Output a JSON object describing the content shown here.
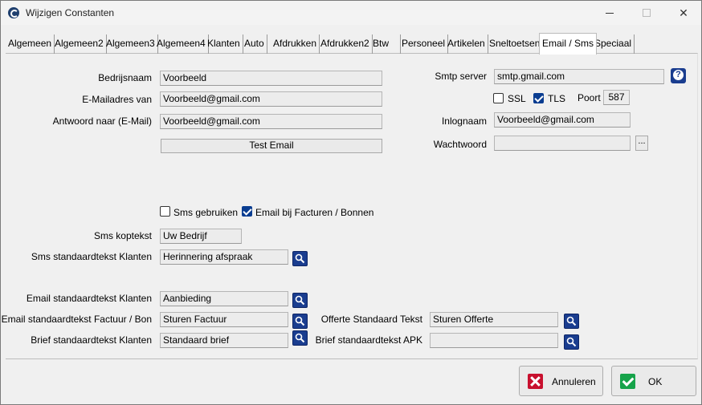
{
  "window": {
    "title": "Wijzigen Constanten"
  },
  "tabs": [
    "Algemeen",
    "Algemeen2",
    "Algemeen3",
    "Algemeen4",
    "Klanten",
    "Auto",
    "Afdrukken",
    "Afdrukken2",
    "Btw",
    "Personeel",
    "Artikelen",
    "Sneltoetsen",
    "Email / Sms",
    "Speciaal"
  ],
  "active_tab": "Email / Sms",
  "email": {
    "bedrijfsnaam_label": "Bedrijsnaam",
    "bedrijfsnaam_value": "Voorbeeld",
    "from_label": "E-Mailadres van",
    "from_value": "Voorbeeld@gmail.com",
    "reply_label": "Antwoord naar (E-Mail)",
    "reply_value": "Voorbeeld@gmail.com",
    "test_button": "Test Email"
  },
  "smtp": {
    "server_label": "Smtp server",
    "server_value": "smtp.gmail.com",
    "ssl_label": "SSL",
    "ssl_checked": false,
    "tls_label": "TLS",
    "tls_checked": true,
    "port_label": "Poort",
    "port_value": "587",
    "login_label": "Inlognaam",
    "login_value": "Voorbeeld@gmail.com",
    "password_label": "Wachtwoord",
    "password_value": "",
    "browse_label": "..."
  },
  "options": {
    "sms_use_label": "Sms gebruiken",
    "sms_use_checked": false,
    "email_invoices_label": "Email bij Facturen / Bonnen",
    "email_invoices_checked": true
  },
  "sms": {
    "header_label": "Sms koptekst",
    "header_value": "Uw Bedrijf",
    "std_text_label": "Sms standaardtekst Klanten",
    "std_text_value": "Herinnering afspraak"
  },
  "templates": {
    "email_customers_label": "Email standaardtekst Klanten",
    "email_customers_value": "Aanbieding",
    "email_invoice_label": "Email standaardtekst Factuur / Bon",
    "email_invoice_value": "Sturen Factuur",
    "letter_customers_label": "Brief standaardtekst Klanten",
    "letter_customers_value": "Standaard brief",
    "quote_label": "Offerte Standaard Tekst",
    "quote_value": "Sturen Offerte",
    "letter_apk_label": "Brief standaardtekst APK",
    "letter_apk_value": ""
  },
  "buttons": {
    "cancel": "Annuleren",
    "ok": "OK"
  }
}
